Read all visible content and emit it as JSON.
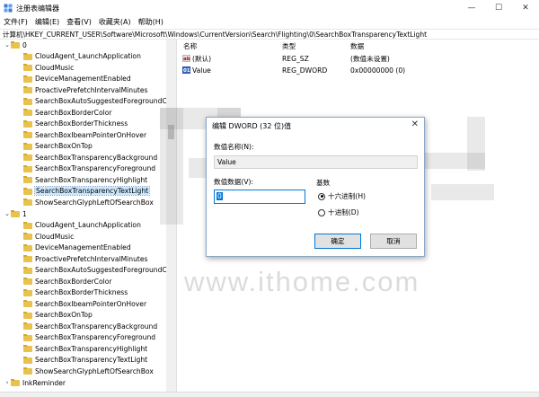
{
  "window": {
    "title": "注册表编辑器",
    "controls": {
      "minimize": "—",
      "maximize": "☐",
      "close": "✕"
    }
  },
  "menu": [
    "文件(F)",
    "编辑(E)",
    "查看(V)",
    "收藏夹(A)",
    "帮助(H)"
  ],
  "address": "计算机\\HKEY_CURRENT_USER\\Software\\Microsoft\\Windows\\CurrentVersion\\Search\\Flighting\\0\\SearchBoxTransparencyTextLight",
  "tree": {
    "group0": {
      "label": "0",
      "items": [
        "CloudAgent_LaunchApplication",
        "CloudMusic",
        "DeviceManagementEnabled",
        "ProactivePrefetchIntervalMinutes",
        "SearchBoxAutoSuggestedForegroundCo",
        "SearchBoxBorderColor",
        "SearchBoxBorderThickness",
        "SearchBoxIbeamPointerOnHover",
        "SearchBoxOnTop",
        "SearchBoxTransparencyBackground",
        "SearchBoxTransparencyForeground",
        "SearchBoxTransparencyHighlight",
        "SearchBoxTransparencyTextLight",
        "ShowSearchGlyphLeftOfSearchBox"
      ]
    },
    "group1": {
      "label": "1",
      "items": [
        "CloudAgent_LaunchApplication",
        "CloudMusic",
        "DeviceManagementEnabled",
        "ProactivePrefetchIntervalMinutes",
        "SearchBoxAutoSuggestedForegroundCo",
        "SearchBoxBorderColor",
        "SearchBoxBorderThickness",
        "SearchBoxIbeamPointerOnHover",
        "SearchBoxOnTop",
        "SearchBoxTransparencyBackground",
        "SearchBoxTransparencyForeground",
        "SearchBoxTransparencyHighlight",
        "SearchBoxTransparencyTextLight",
        "ShowSearchGlyphLeftOfSearchBox"
      ]
    },
    "last": "InkReminder"
  },
  "list": {
    "columns": {
      "name": "名称",
      "type": "类型",
      "data": "数据"
    },
    "rows": [
      {
        "icon": "ab",
        "name": "(默认)",
        "type": "REG_SZ",
        "data": "(数值未设置)"
      },
      {
        "icon": "01",
        "name": "Value",
        "type": "REG_DWORD",
        "data": "0x00000000 (0)"
      }
    ]
  },
  "dialog": {
    "title": "编辑 DWORD (32 位)值",
    "close": "✕",
    "name_label": "数值名称(N):",
    "name_value": "Value",
    "data_label": "数值数据(V):",
    "data_value": "0",
    "base_label": "基数",
    "radio_hex": "十六进制(H)",
    "radio_dec": "十进制(D)",
    "ok": "确定",
    "cancel": "取消"
  },
  "watermark": "www.ithome.com"
}
